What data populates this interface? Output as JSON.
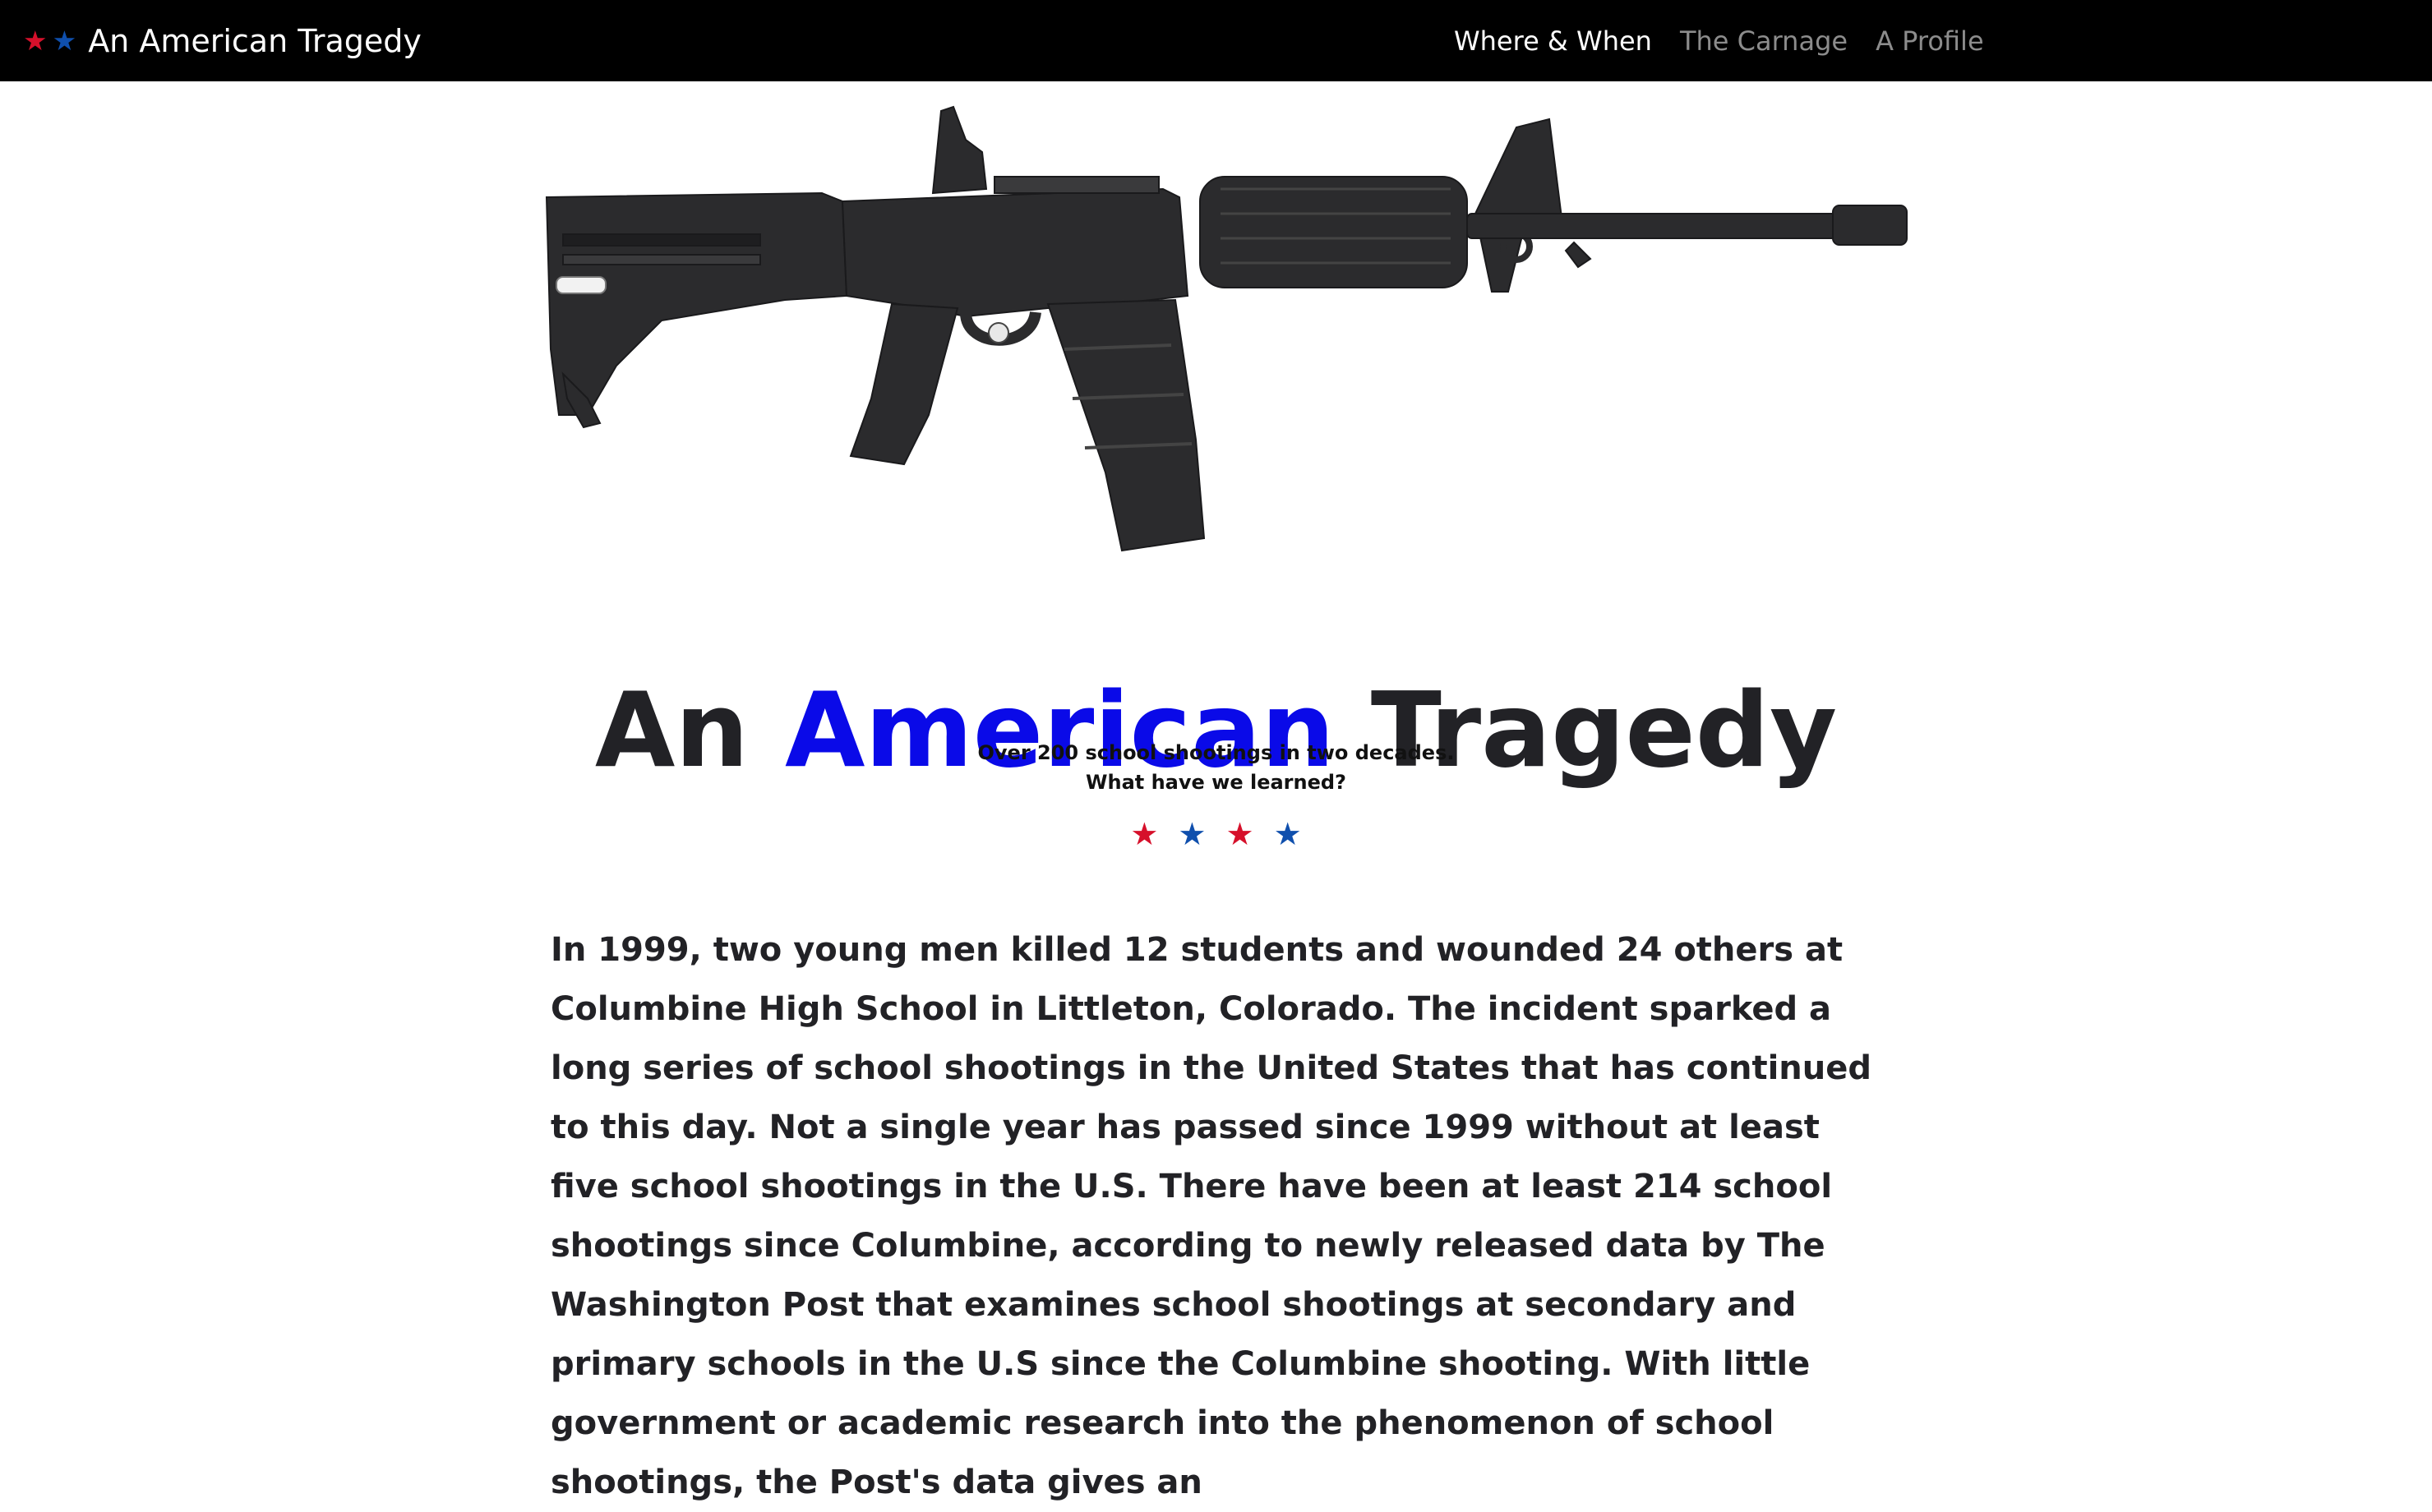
{
  "nav": {
    "brand": {
      "title": "An American Tragedy",
      "stars": [
        {
          "glyph": "★",
          "color": "#d6102b"
        },
        {
          "glyph": "★",
          "color": "#0f4fad"
        }
      ]
    },
    "links": [
      {
        "label": "Where & When",
        "active": true
      },
      {
        "label": "The Carnage",
        "active": false
      },
      {
        "label": "A Profile",
        "active": false
      }
    ]
  },
  "hero": {
    "image_label": "assault rifle image",
    "title_part1": "An",
    "title_accent": "American",
    "title_part2": "Tragedy",
    "accent_color": "#0a0ae8",
    "subtitle_line1": "Over 200 school shootings in two decades.",
    "subtitle_line2": "What have we learned?",
    "divider_stars": [
      {
        "glyph": "★",
        "color": "#d6102b"
      },
      {
        "glyph": "★",
        "color": "#0f4fad"
      },
      {
        "glyph": "★",
        "color": "#d6102b"
      },
      {
        "glyph": "★",
        "color": "#0f4fad"
      }
    ]
  },
  "article": {
    "paragraph": "In 1999, two young men killed 12 students and wounded 24 others at Columbine High School in Littleton, Colorado. The incident sparked a long series of school shootings in the United States that has continued to this day. Not a single year has passed since 1999 without at least five school shootings in the U.S. There have been at least 214 school shootings since Columbine, according to newly released data by The Washington Post that examines school shootings at secondary and primary schools in the U.S since the Columbine shooting. With little government or academic research into the phenomenon of school shootings, the Post's data gives an"
  }
}
